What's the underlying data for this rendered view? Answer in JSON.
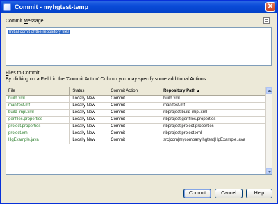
{
  "window": {
    "title": "Commit - myhgtest-temp",
    "close": "✕"
  },
  "commit_message": {
    "label_pre": "Commit ",
    "label_ul": "M",
    "label_post": "essage:",
    "value": "Initial comit of the repository files"
  },
  "files": {
    "label_ul": "F",
    "label_post": "iles to Commit.",
    "hint": "By clicking on a Field in the 'Commit Action' Column you may specify some additional Actions.",
    "columns": [
      "File",
      "Status",
      "Commit Action",
      "Repository Path",
      "▲"
    ],
    "rows": [
      {
        "file": "build.xml",
        "status": "Locally New",
        "action": "Commit",
        "path": "build.xml"
      },
      {
        "file": "manifest.mf",
        "status": "Locally New",
        "action": "Commit",
        "path": "manifest.mf"
      },
      {
        "file": "build-impl.xml",
        "status": "Locally New",
        "action": "Commit",
        "path": "nbproject|build-impl.xml"
      },
      {
        "file": "genfiles.properties",
        "status": "Locally New",
        "action": "Commit",
        "path": "nbproject|genfiles.properties"
      },
      {
        "file": "project.properties",
        "status": "Locally New",
        "action": "Commit",
        "path": "nbproject|project.properties"
      },
      {
        "file": "project.xml",
        "status": "Locally New",
        "action": "Commit",
        "path": "nbproject|project.xml"
      },
      {
        "file": "HgExample.java",
        "status": "Locally New",
        "action": "Commit",
        "path": "src|com|mycompany|hgtest|HgExample.java"
      }
    ]
  },
  "buttons": {
    "commit_label": "Commit",
    "cancel_label": "Cancel",
    "help_label": "Help"
  },
  "colors": {
    "titlebar": "#0a4bd8",
    "file_text": "#2b7d2b",
    "selection": "#316ac5"
  }
}
